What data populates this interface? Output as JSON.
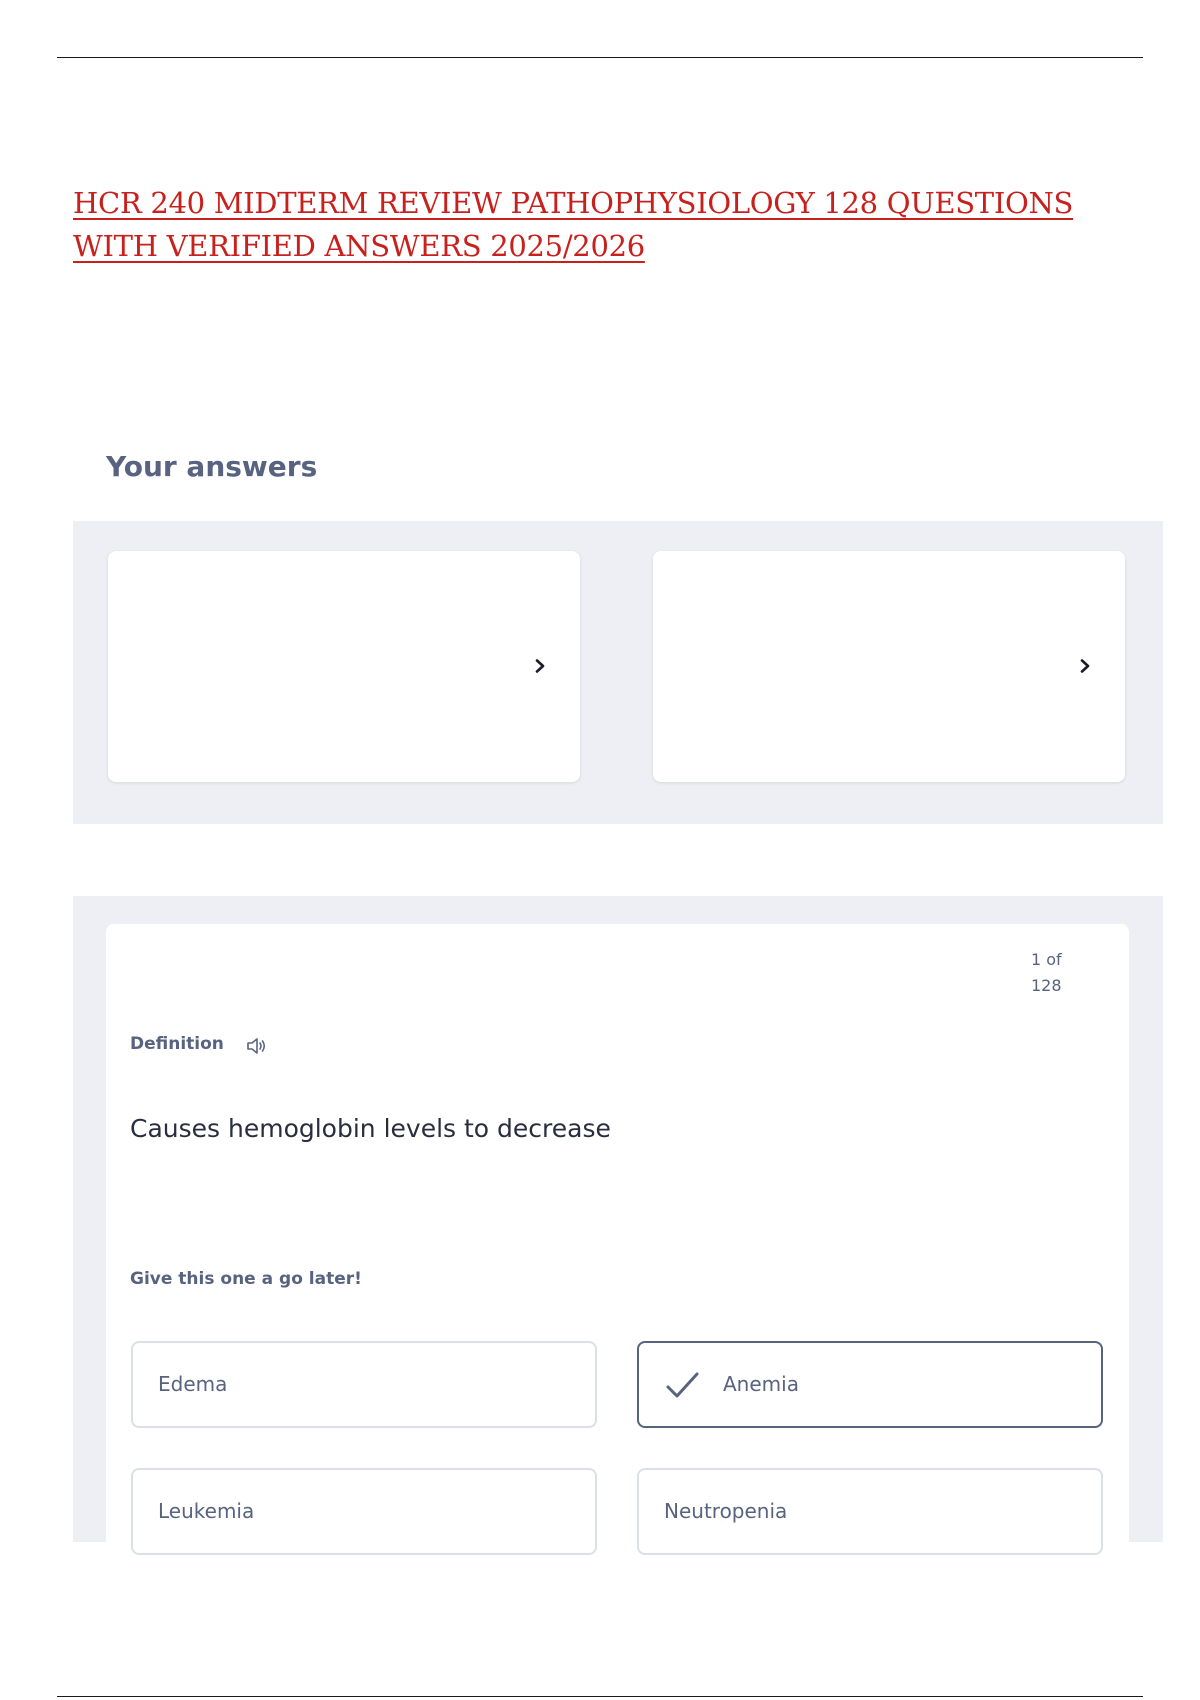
{
  "document": {
    "title_lines": [
      "HCR 240 MIDTERM REVIEW PATHOPHYSIOLOGY 128 QUESTIONS ",
      "WITH VERIFIED ANSWERS 2025/2026"
    ]
  },
  "answers_section": {
    "heading": "Your answers",
    "cards": [
      {
        "icon": "chevron-right-icon"
      },
      {
        "icon": "chevron-right-icon"
      }
    ]
  },
  "question": {
    "counter_current": "1 of",
    "counter_total": "128",
    "label": "Definition",
    "audio_icon": "speaker-icon",
    "prompt": "Causes hemoglobin levels to decrease",
    "skip_text": "Give this one a go later!",
    "options": [
      {
        "label": "Edema",
        "selected": false
      },
      {
        "label": "Anemia",
        "selected": true,
        "icon": "checkmark-icon"
      },
      {
        "label": "Leukemia",
        "selected": false
      },
      {
        "label": "Neutropenia",
        "selected": false
      }
    ]
  },
  "colors": {
    "title_red": "#c8211d",
    "muted_text": "#586380",
    "panel_bg": "#edeff4",
    "option_border": "#dbdfe8"
  }
}
